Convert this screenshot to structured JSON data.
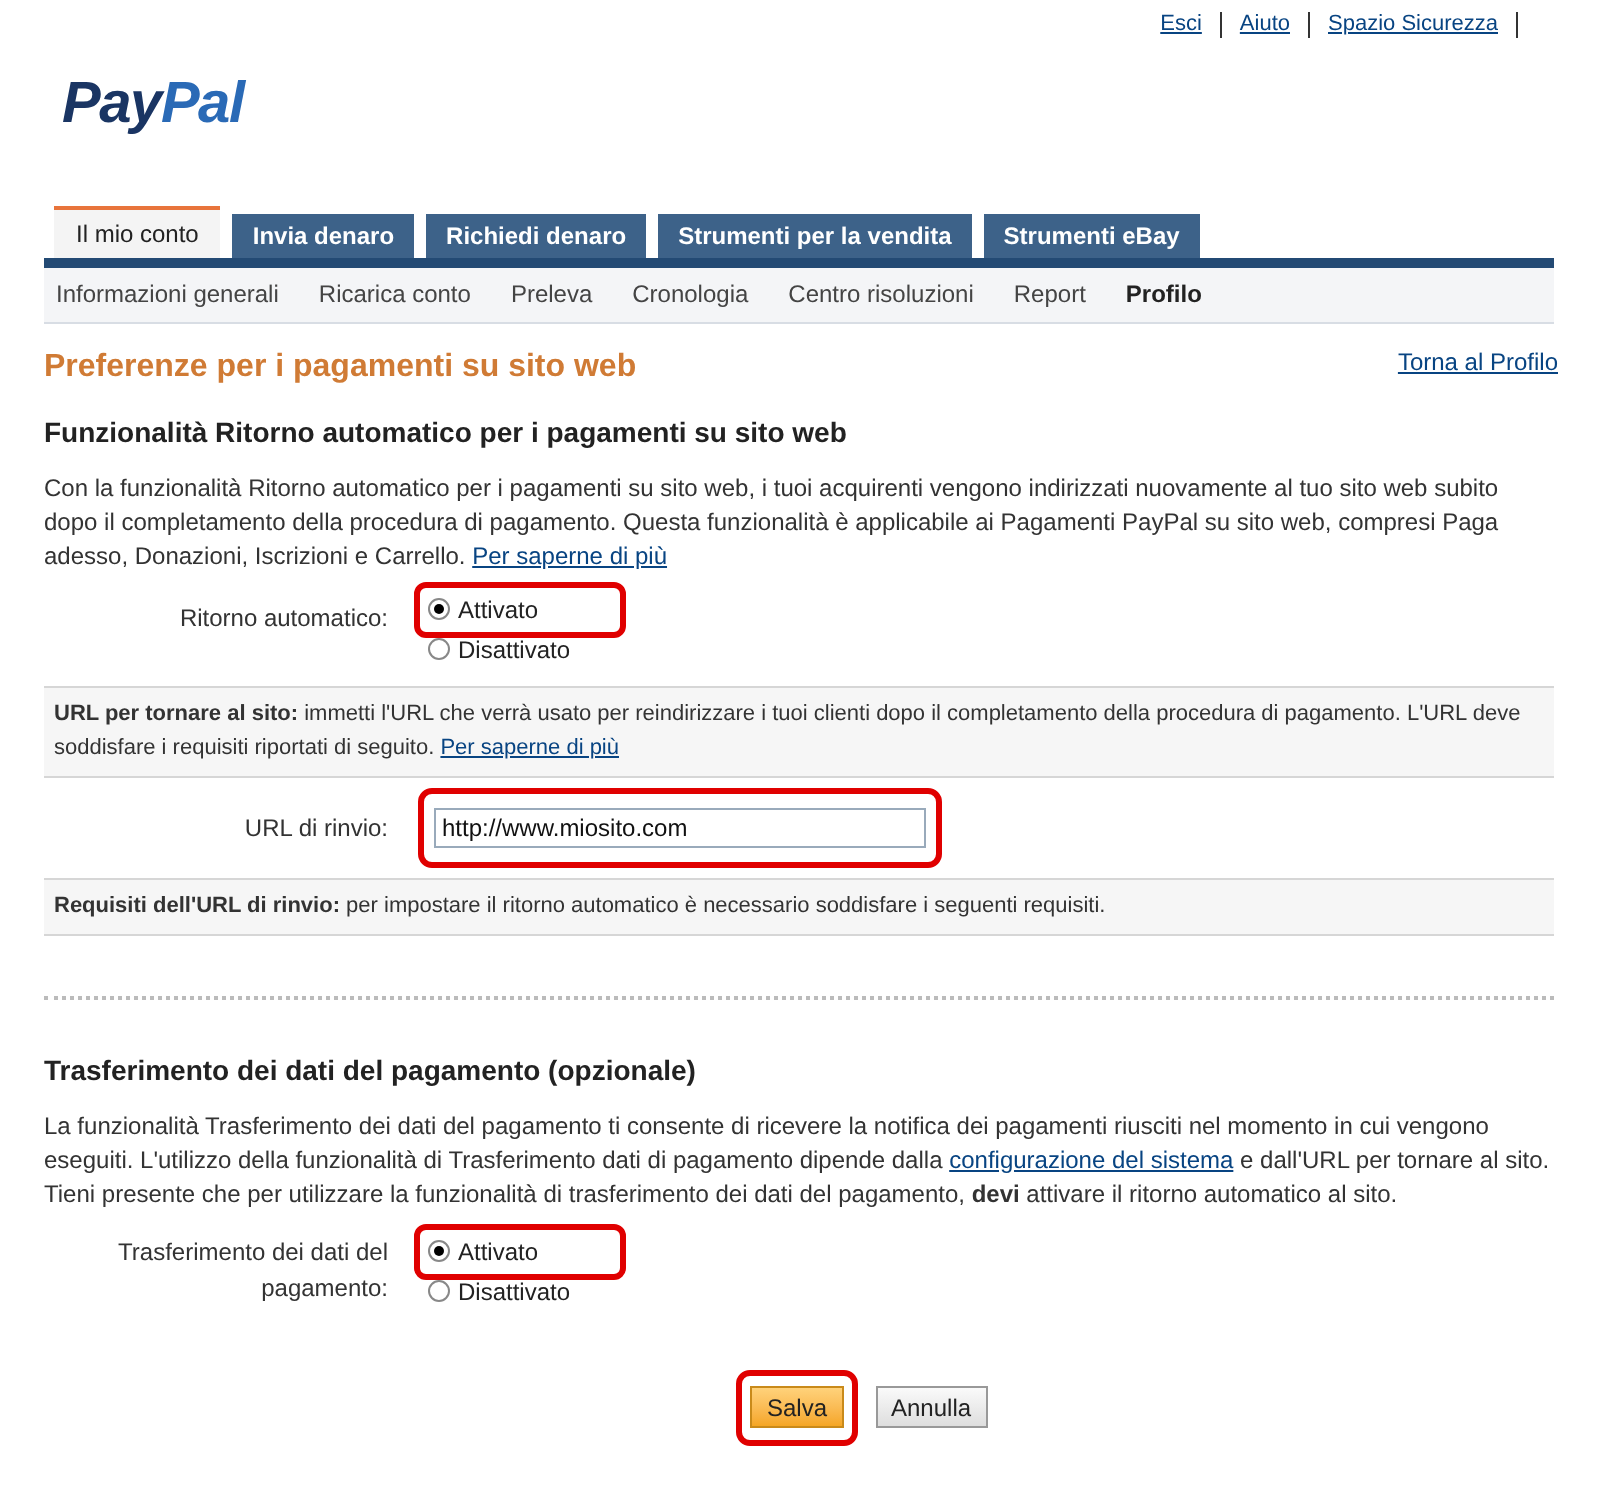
{
  "top_links": [
    "Esci",
    "Aiuto",
    "Spazio Sicurezza"
  ],
  "logo": {
    "part1": "Pay",
    "part2": "Pal"
  },
  "tabs": [
    {
      "label": "Il mio conto",
      "selected": true
    },
    {
      "label": "Invia denaro",
      "selected": false
    },
    {
      "label": "Richiedi denaro",
      "selected": false
    },
    {
      "label": "Strumenti per la vendita",
      "selected": false
    },
    {
      "label": "Strumenti eBay",
      "selected": false
    }
  ],
  "subnav": [
    {
      "label": "Informazioni generali",
      "selected": false
    },
    {
      "label": "Ricarica conto",
      "selected": false
    },
    {
      "label": "Preleva",
      "selected": false
    },
    {
      "label": "Cronologia",
      "selected": false
    },
    {
      "label": "Centro risoluzioni",
      "selected": false
    },
    {
      "label": "Report",
      "selected": false
    },
    {
      "label": "Profilo",
      "selected": true
    }
  ],
  "page_title": "Preferenze per i pagamenti su sito web",
  "back_link": "Torna al Profilo",
  "section1": {
    "heading": "Funzionalità Ritorno automatico per i pagamenti su sito web",
    "text": "Con la funzionalità Ritorno automatico per i pagamenti su sito web, i tuoi acquirenti vengono indirizzati nuovamente al tuo sito web subito dopo il completamento della procedura di pagamento. Questa funzionalità è applicabile ai Pagamenti PayPal su sito web, compresi Paga adesso, Donazioni, Iscrizioni e Carrello.",
    "link": "Per saperne di più",
    "field_label": "Ritorno automatico:",
    "options": [
      {
        "label": "Attivato",
        "selected": true,
        "highlighted": true
      },
      {
        "label": "Disattivato",
        "selected": false,
        "highlighted": false
      }
    ],
    "info": {
      "text": "**URL per tornare al sito:** immetti l'URL che verrà usato per reindirizzare i tuoi clienti dopo il completamento della procedura di pagamento. L'URL deve soddisfare i requisiti riportati di seguito.",
      "link": "Per saperne di più"
    },
    "url_label": "URL di rinvio:",
    "url": {
      "value": "http://www.miosito.com",
      "highlighted": true
    },
    "requirements": "**Requisiti dell'URL di rinvio:** per impostare il ritorno automatico è necessario soddisfare i seguenti requisiti."
  },
  "section2": {
    "heading": "Trasferimento dei dati del pagamento (opzionale)",
    "text_before": "La funzionalità Trasferimento dei dati del pagamento ti consente di ricevere la notifica dei pagamenti riusciti nel momento in cui vengono eseguiti. L'utilizzo della funzionalità di Trasferimento dati di pagamento dipende dalla",
    "link": "configurazione del sistema",
    "text_after": "e dall'URL per tornare al sito. Tieni presente che per utilizzare la funzionalità di trasferimento dei dati del pagamento, **devi** attivare il ritorno automatico al sito.",
    "field_label": "Trasferimento dei dati del pagamento:",
    "options": [
      {
        "label": "Attivato",
        "selected": true,
        "highlighted": true
      },
      {
        "label": "Disattivato",
        "selected": false,
        "highlighted": false
      }
    ]
  },
  "buttons": [
    {
      "label": "Salva",
      "kind": "primary",
      "highlighted": true
    },
    {
      "label": "Annulla",
      "kind": "secondary",
      "highlighted": false
    }
  ]
}
